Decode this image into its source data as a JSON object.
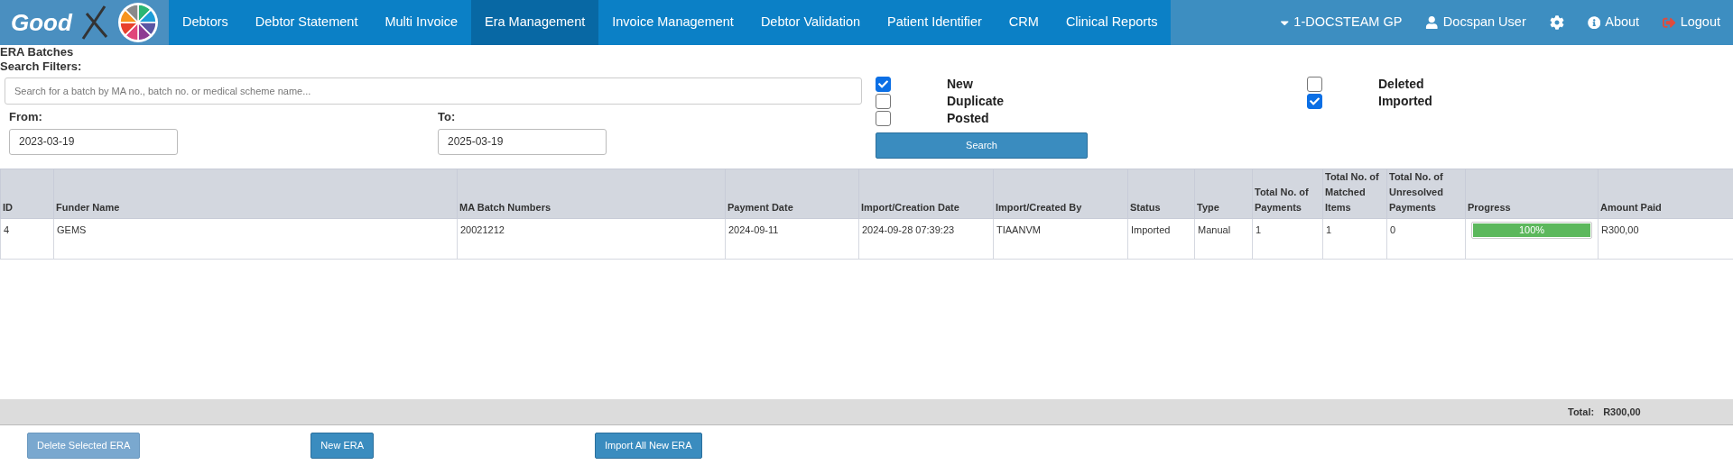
{
  "nav": {
    "items": [
      {
        "label": "Debtors",
        "selected": false
      },
      {
        "label": "Debtor Statement",
        "selected": false
      },
      {
        "label": "Multi Invoice",
        "selected": false
      },
      {
        "label": "Era Management",
        "selected": true
      },
      {
        "label": "Invoice Management",
        "selected": false
      },
      {
        "label": "Debtor Validation",
        "selected": false
      },
      {
        "label": "Patient Identifier",
        "selected": false
      },
      {
        "label": "CRM",
        "selected": false
      },
      {
        "label": "Clinical Reports",
        "selected": false
      }
    ],
    "logo_text": "Good",
    "practice": "1-DOCSTEAM GP",
    "user": "Docspan User",
    "about": "About",
    "logout": "Logout"
  },
  "page_title": "ERA Batches",
  "filters": {
    "heading": "Search Filters:",
    "search": {
      "placeholder": "Search for a batch by MA no., batch no. or medical scheme name..."
    },
    "from": {
      "label": "From:",
      "value": "2023-03-19"
    },
    "to": {
      "label": "To:",
      "value": "2025-03-19"
    },
    "checkbox_columns": [
      [
        {
          "label": "New",
          "checked": true
        },
        {
          "label": "Duplicate",
          "checked": false
        },
        {
          "label": "Posted",
          "checked": false
        }
      ],
      [
        {
          "label": "Deleted",
          "checked": false
        },
        {
          "label": "Imported",
          "checked": true
        }
      ]
    ],
    "search_button": "Search"
  },
  "table": {
    "columns": [
      "ID",
      "Funder Name",
      "MA Batch Numbers",
      "Payment Date",
      "Import/Creation Date",
      "Import/Created By",
      "Status",
      "Type",
      "Total No. of Payments",
      "Total No. of Matched Items",
      "Total No. of Unresolved Payments",
      "Progress",
      "Amount Paid"
    ],
    "rows": [
      {
        "cells": [
          "4",
          "GEMS",
          "20021212",
          "2024-09-11",
          "2024-09-28 07:39:23",
          "TIAANVM",
          "Imported",
          "Manual",
          "1",
          "1",
          "0"
        ],
        "progress": {
          "level": 1,
          "label": "100%"
        },
        "amount": "R300,00"
      }
    ]
  },
  "footer": {
    "total_label": "Total:",
    "total_value": "R300,00"
  },
  "buttons": [
    {
      "label": "Delete Selected ERA",
      "disabled": true
    },
    {
      "label": "New ERA",
      "disabled": false
    },
    {
      "label": "Import All New ERA",
      "disabled": false
    }
  ]
}
